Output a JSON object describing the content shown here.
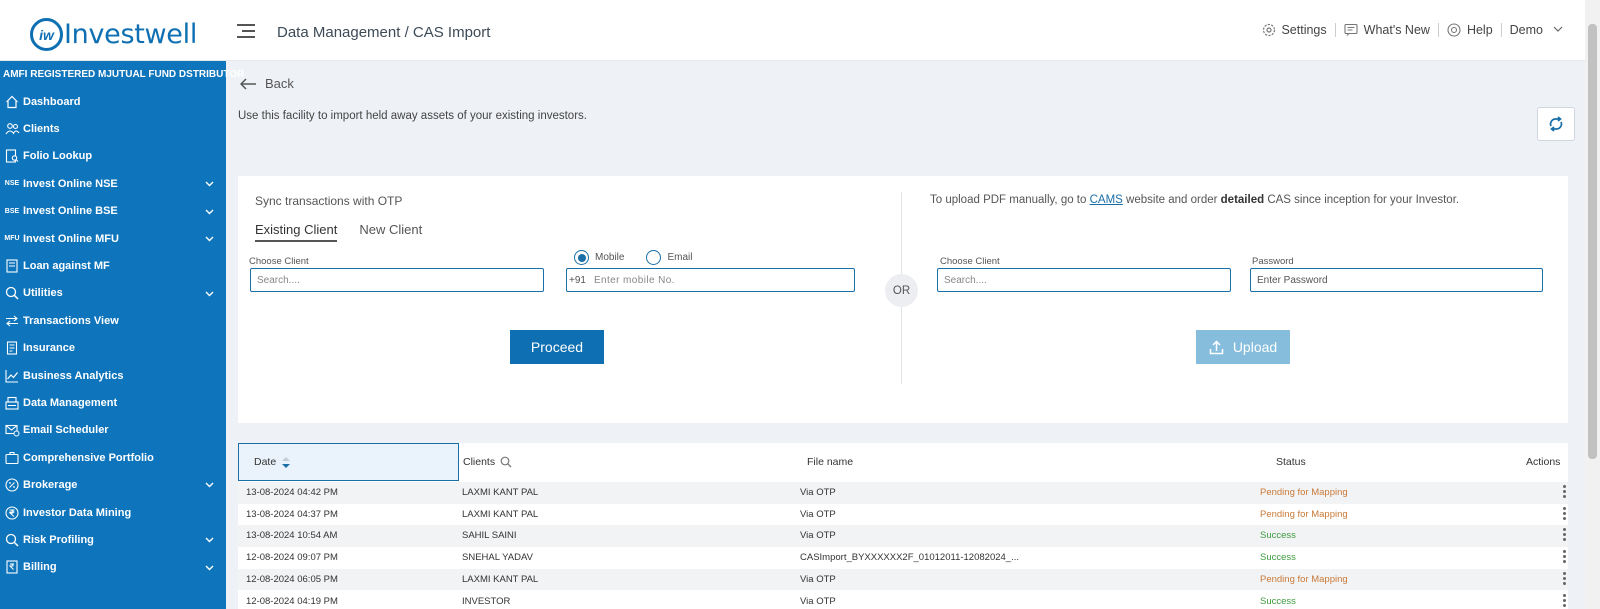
{
  "header": {
    "logo_mark": "iw",
    "logo_text": "Investwell",
    "breadcrumb": "Data Management / CAS Import",
    "settings": "Settings",
    "whats_new": "What's New",
    "help": "Help",
    "user": "Demo"
  },
  "sidebar": {
    "heading": "AMFI REGISTERED MJUTUAL FUND DSTRIBUTOR",
    "items": [
      {
        "label": "Dashboard",
        "icon": "home-icon",
        "caret": false
      },
      {
        "label": "Clients",
        "icon": "users-icon",
        "caret": false
      },
      {
        "label": "Folio Lookup",
        "icon": "folio-icon",
        "caret": false
      },
      {
        "label": "Invest Online NSE",
        "icon": "nse-icon",
        "badge": "NSE",
        "caret": true
      },
      {
        "label": "Invest Online BSE",
        "icon": "bse-icon",
        "badge": "BSE",
        "caret": true
      },
      {
        "label": "Invest Online MFU",
        "icon": "mfu-icon",
        "badge": "MFU",
        "caret": true
      },
      {
        "label": "Loan against MF",
        "icon": "loan-icon",
        "caret": false
      },
      {
        "label": "Utilities",
        "icon": "utilities-icon",
        "caret": true
      },
      {
        "label": "Transactions View",
        "icon": "transfer-icon",
        "caret": false
      },
      {
        "label": "Insurance",
        "icon": "insurance-icon",
        "caret": false
      },
      {
        "label": "Business Analytics",
        "icon": "chart-icon",
        "caret": false
      },
      {
        "label": "Data Management",
        "icon": "data-icon",
        "caret": false
      },
      {
        "label": "Email Scheduler",
        "icon": "email-icon",
        "caret": false
      },
      {
        "label": "Comprehensive Portfolio",
        "icon": "portfolio-icon",
        "caret": false
      },
      {
        "label": "Brokerage",
        "icon": "percent-icon",
        "caret": true
      },
      {
        "label": "Investor Data Mining",
        "icon": "rupee-icon",
        "caret": false
      },
      {
        "label": "Risk Profiling",
        "icon": "risk-icon",
        "caret": true
      },
      {
        "label": "Billing",
        "icon": "billing-icon",
        "caret": true
      }
    ]
  },
  "page": {
    "back": "Back",
    "intro": "Use this facility to import held away assets of your existing investors."
  },
  "sync": {
    "title": "Sync transactions with OTP",
    "tab_existing": "Existing Client",
    "tab_new": "New Client",
    "choose_client_label": "Choose Client",
    "choose_client_placeholder": "Search....",
    "radio_mobile": "Mobile",
    "radio_email": "Email",
    "country_code": "+91",
    "mobile_placeholder": "Enter mobile No.",
    "proceed": "Proceed"
  },
  "or_label": "OR",
  "upload": {
    "note_prefix": "To upload PDF manually, go to ",
    "note_link": "CAMS",
    "note_middle": " website and order ",
    "note_bold": "detailed",
    "note_suffix": " CAS since inception for your Investor.",
    "choose_client_label": "Choose Client",
    "choose_client_placeholder": "Search....",
    "password_label": "Password",
    "password_placeholder": "Enter Password",
    "upload_button": "Upload"
  },
  "table": {
    "headers": {
      "date": "Date",
      "clients": "Clients",
      "file_name": "File name",
      "status": "Status",
      "actions": "Actions"
    },
    "rows": [
      {
        "date": "13-08-2024 04:42 PM",
        "client": "LAXMI KANT PAL",
        "file": "Via OTP",
        "status": "Pending for Mapping",
        "kind": "pending"
      },
      {
        "date": "13-08-2024 04:37 PM",
        "client": "LAXMI KANT PAL",
        "file": "Via OTP",
        "status": "Pending for Mapping",
        "kind": "pending"
      },
      {
        "date": "13-08-2024 10:54 AM",
        "client": "SAHIL SAINI",
        "file": "Via OTP",
        "status": "Success",
        "kind": "success"
      },
      {
        "date": "12-08-2024 09:07 PM",
        "client": "SNEHAL YADAV",
        "file": "CASImport_BYXXXXXX2F_01012011-12082024_...",
        "status": "Success",
        "kind": "success"
      },
      {
        "date": "12-08-2024 06:05 PM",
        "client": "LAXMI KANT PAL",
        "file": "Via OTP",
        "status": "Pending for Mapping",
        "kind": "pending"
      },
      {
        "date": "12-08-2024 04:19 PM",
        "client": "INVESTOR",
        "file": "Via OTP",
        "status": "Success",
        "kind": "success"
      }
    ]
  },
  "colors": {
    "brand": "#0e74bb",
    "pending": "#c97a38",
    "success": "#3f9b41"
  }
}
